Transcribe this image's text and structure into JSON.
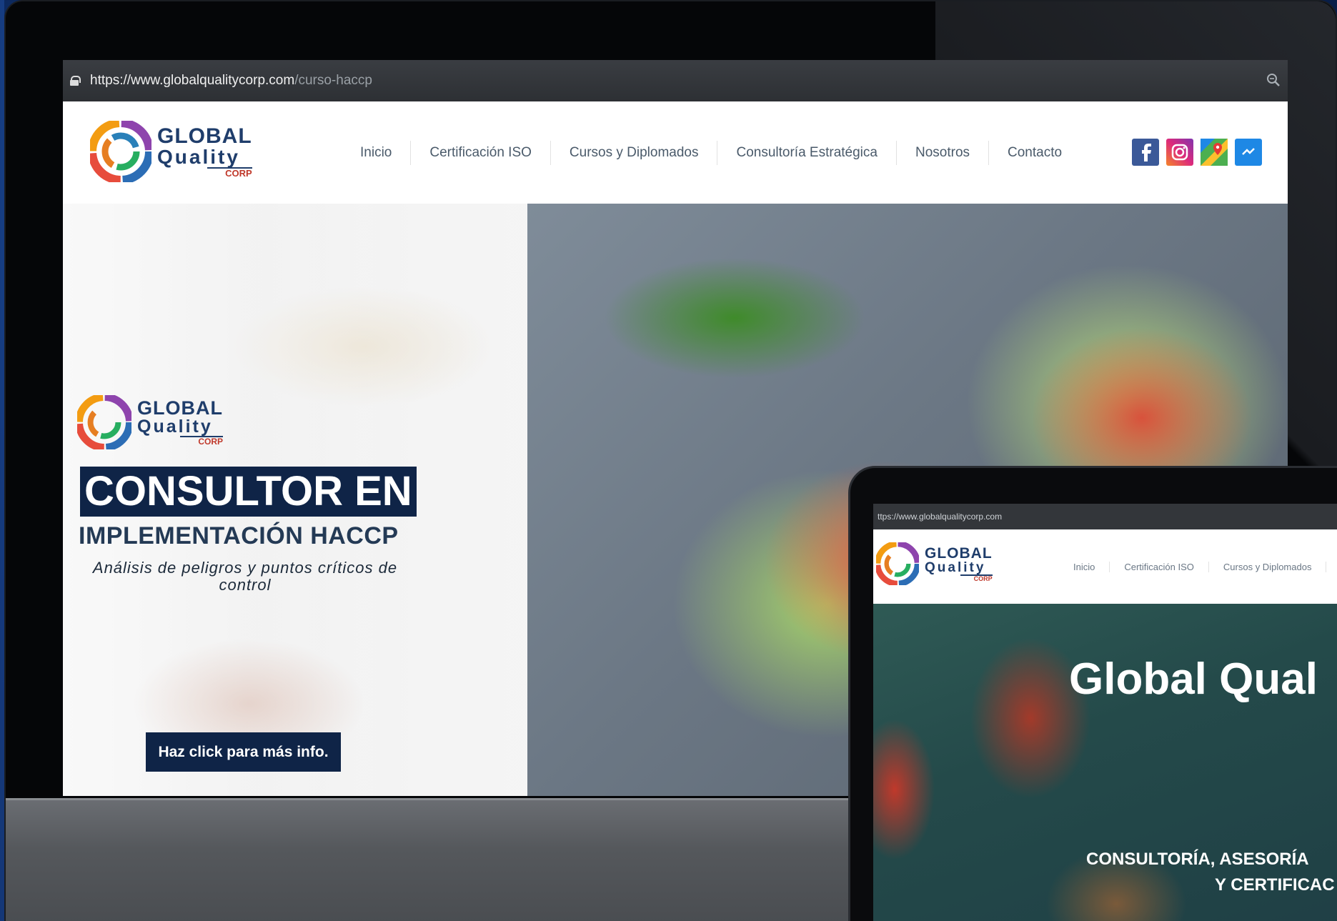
{
  "main_browser": {
    "url_host": "https://www.globalqualitycorp.com",
    "url_path": "/curso-haccp",
    "header": {
      "logo": {
        "line1": "GLOBAL",
        "line2": "Quality",
        "line3": "CORP"
      },
      "nav": [
        "Inicio",
        "Certificación ISO",
        "Cursos y Diplomados",
        "Consultoría Estratégica",
        "Nosotros",
        "Contacto"
      ],
      "socials": [
        {
          "icon": "facebook-icon",
          "color": "#3b5998"
        },
        {
          "icon": "instagram-icon",
          "color": "#e4405f"
        },
        {
          "icon": "google-maps-icon",
          "color": "#34a853"
        },
        {
          "icon": "messenger-icon",
          "color": "#1e88e5"
        }
      ]
    },
    "hero": {
      "logo": {
        "line1": "GLOBAL",
        "line2": "Quality",
        "line3": "CORP"
      },
      "title": "CONSULTOR EN",
      "subtitle": "IMPLEMENTACIÓN HACCP",
      "description": "Análisis de peligros y puntos críticos de control",
      "button": "Haz click para más info."
    }
  },
  "tablet_browser": {
    "url": "ttps://www.globalqualitycorp.com",
    "header": {
      "logo": {
        "line1": "GLOBAL",
        "line2": "Quality",
        "line3": "CORP"
      },
      "nav": [
        "Inicio",
        "Certificación ISO",
        "Cursos y Diplomados"
      ]
    },
    "hero": {
      "title": "Global Qual",
      "subtitle_line1": "CONSULTORÍA, ASESORÍA",
      "subtitle_line2": "Y CERTIFICAC"
    }
  },
  "colors": {
    "navy": "#0f2447",
    "logo_blue": "#1f3d6b",
    "logo_red": "#c0392b",
    "background_blue": "#0b2455"
  }
}
